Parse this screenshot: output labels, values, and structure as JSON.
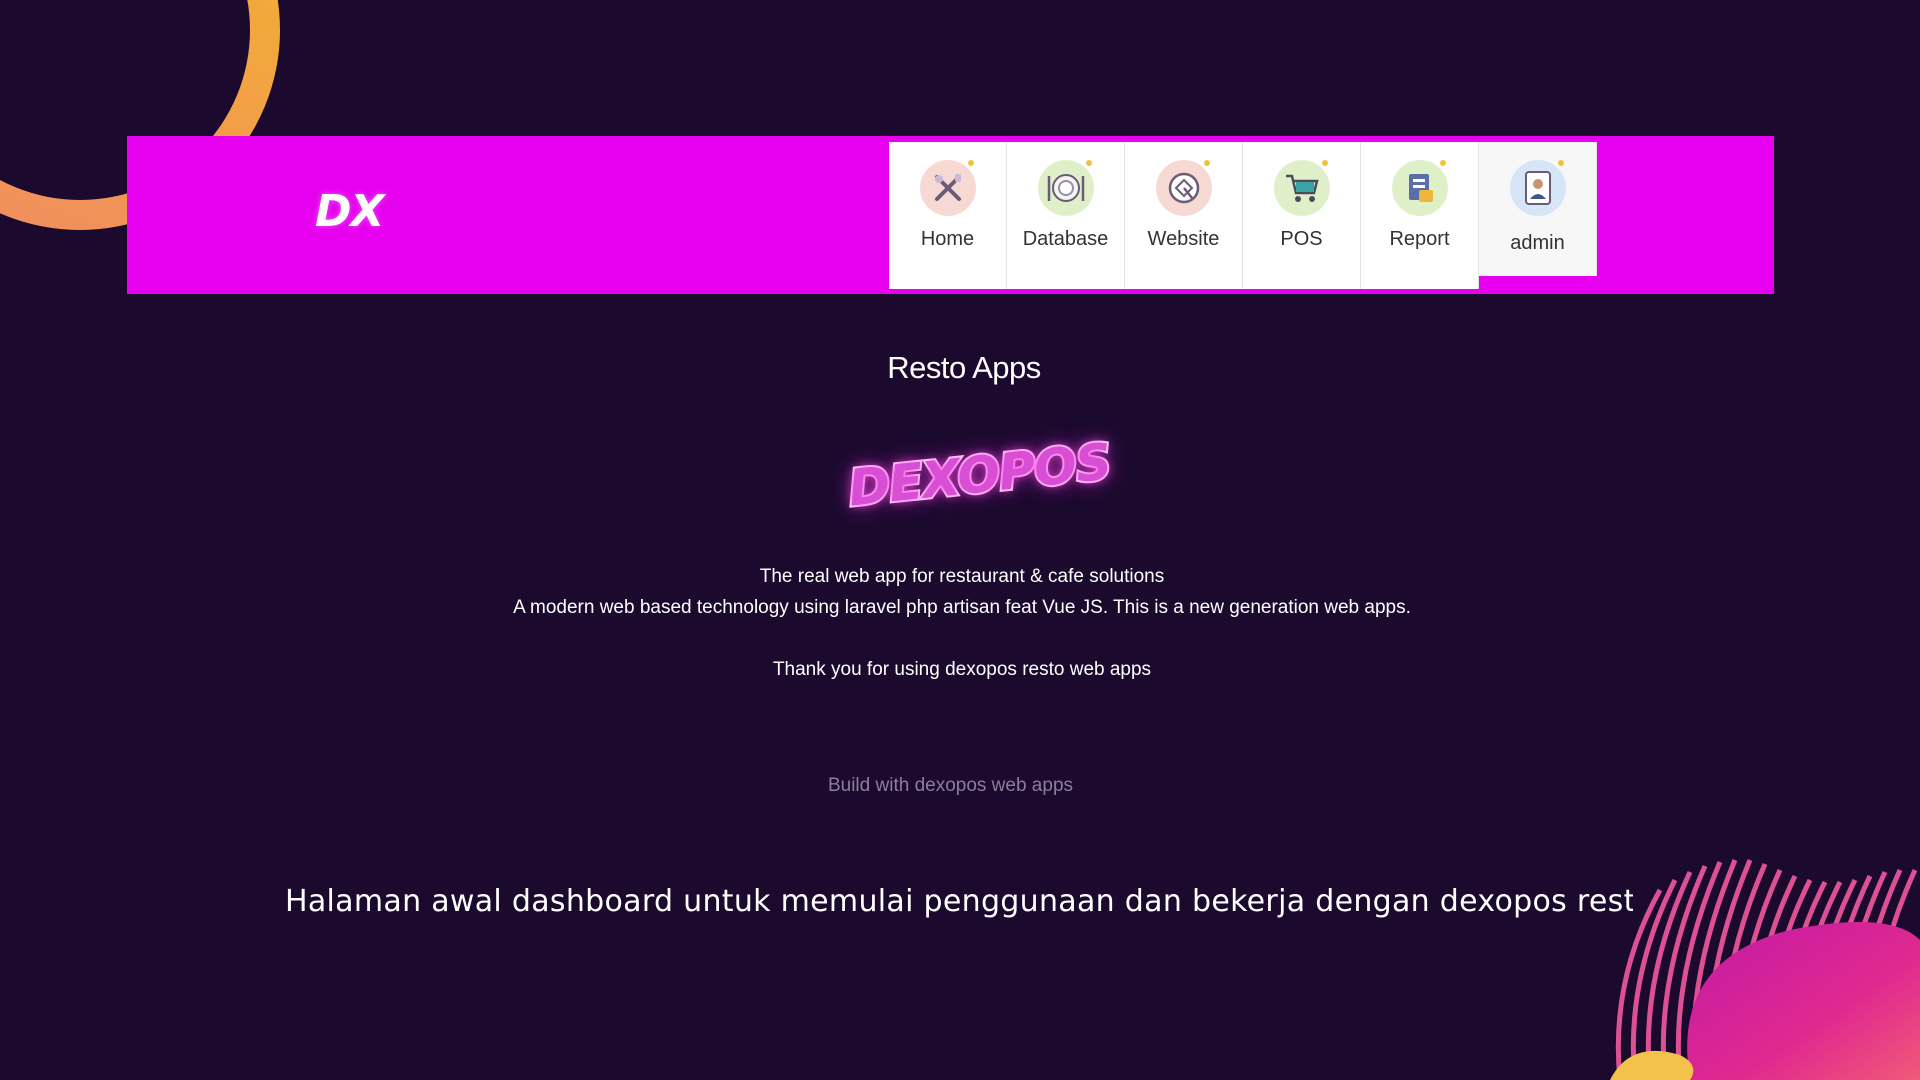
{
  "navbar": {
    "brand": "DX",
    "menu": [
      {
        "label": "Home",
        "icon": "utensils-icon"
      },
      {
        "label": "Database",
        "icon": "plate-icon"
      },
      {
        "label": "Website",
        "icon": "globe-icon"
      },
      {
        "label": "POS",
        "icon": "cart-icon"
      },
      {
        "label": "Report",
        "icon": "report-icon"
      },
      {
        "label": "admin",
        "icon": "user-icon"
      }
    ]
  },
  "main": {
    "title": "Resto Apps",
    "logo_text": "DEXOPOS",
    "tagline": "The real web app for restaurant & cafe solutions",
    "description": "A modern web based technology using laravel php artisan feat Vue JS. This is a new generation web apps.",
    "thanks": "Thank you for using dexopos resto web apps",
    "footer": "Build with dexopos web apps"
  },
  "caption": "Halaman awal dashboard untuk memulai penggunaan dan bekerja dengan dexopos resto apps",
  "colors": {
    "background": "#1b0a2e",
    "navbar": "#e600ef",
    "logo": "#d84fd5",
    "ring": "#f3b52c"
  }
}
